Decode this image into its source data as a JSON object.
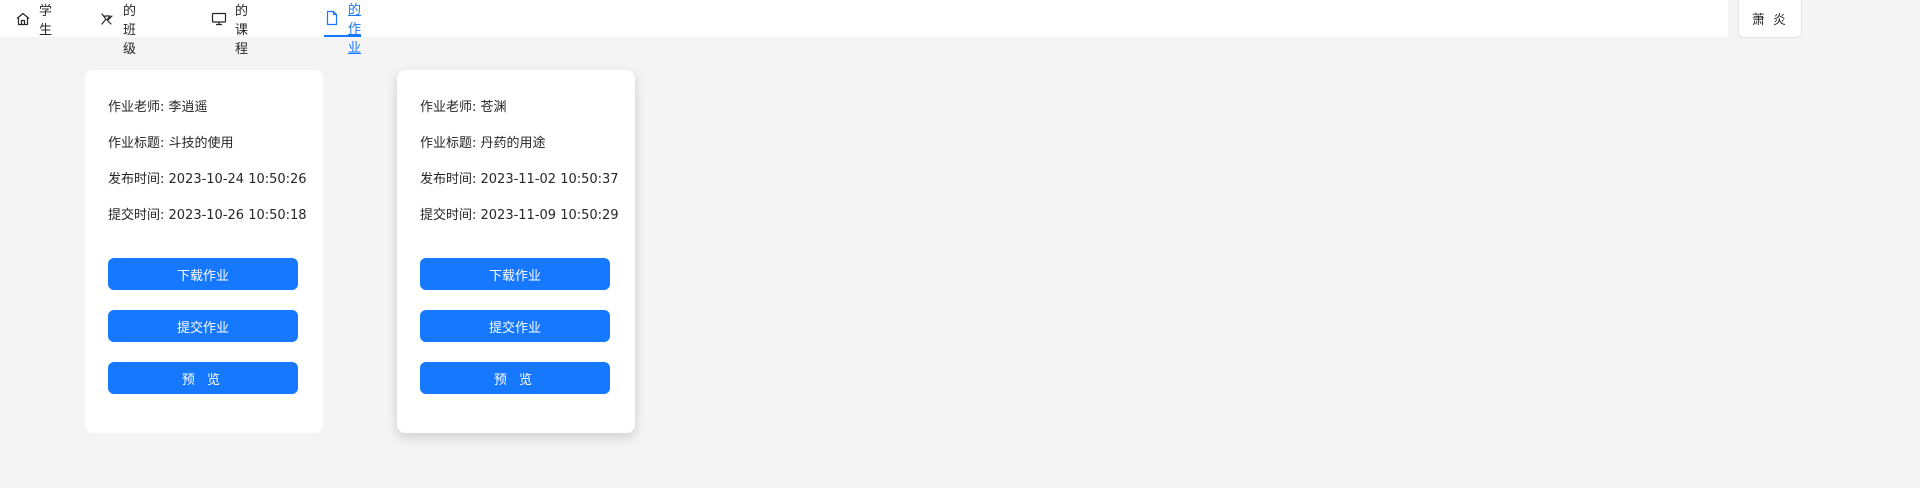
{
  "nav": {
    "items": [
      {
        "label": "学生",
        "icon": "home-icon",
        "active": false
      },
      {
        "label": "我的班级",
        "icon": "class-icon",
        "active": false
      },
      {
        "label": "我的课程",
        "icon": "monitor-icon",
        "active": false
      },
      {
        "label": "我的作业",
        "icon": "file-icon",
        "active": true
      }
    ]
  },
  "user": {
    "name": "萧 炎"
  },
  "cards": [
    {
      "teacher": "作业老师: 李逍遥",
      "title": "作业标题: 斗技的使用",
      "publish": "发布时间: 2023-10-24 10:50:26",
      "submit": "提交时间: 2023-10-26 10:50:18",
      "download_label": "下载作业",
      "submit_label": "提交作业",
      "preview_label": "预 览"
    },
    {
      "teacher": "作业老师: 苍渊",
      "title": "作业标题: 丹药的用途",
      "publish": "发布时间: 2023-11-02 10:50:37",
      "submit": "提交时间: 2023-11-09 10:50:29",
      "download_label": "下载作业",
      "submit_label": "提交作业",
      "preview_label": "预 览"
    }
  ],
  "colors": {
    "accent": "#1677ff",
    "background": "#f4f4f4",
    "card": "#ffffff",
    "text": "#262626"
  }
}
